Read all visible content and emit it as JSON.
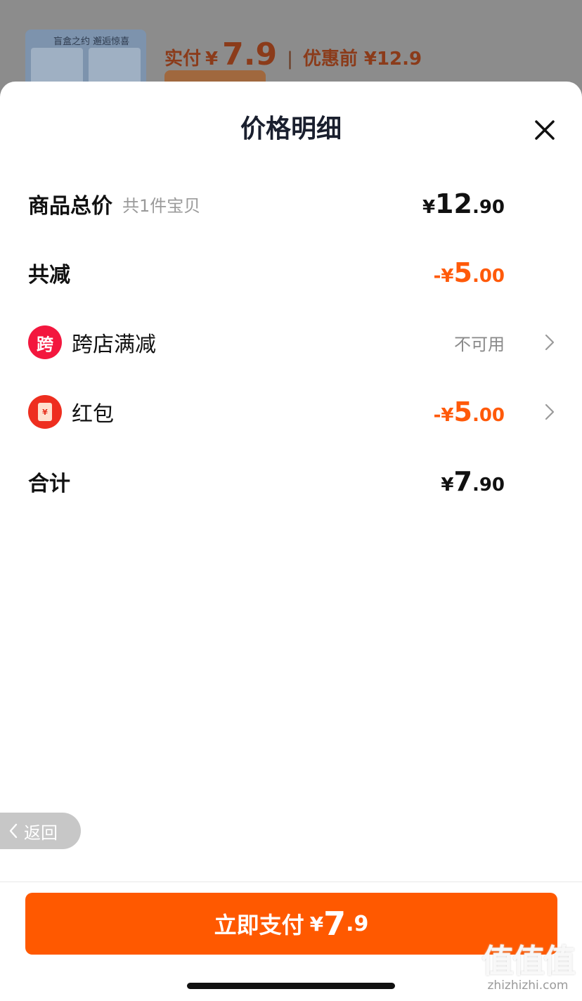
{
  "background": {
    "thumb_title": "盲盒之约 邂逅惊喜",
    "paid_label": "实付",
    "paid_currency": "¥",
    "paid_amount": "7.9",
    "separator": "|",
    "before_discount": "优惠前 ¥12.9"
  },
  "sheet": {
    "title": "价格明细",
    "close_icon": "close-icon"
  },
  "rows": {
    "total": {
      "label": "商品总价",
      "sub": "共1件宝贝",
      "currency": "¥",
      "int": "12",
      "dec": ".90"
    },
    "discount": {
      "label": "共减",
      "sign": "-¥",
      "int": "5",
      "dec": ".00",
      "color": "#ff5a0a"
    },
    "cross_store": {
      "badge": "跨",
      "label": "跨店满减",
      "status": "不可用"
    },
    "red_packet": {
      "badge_symbol": "¥",
      "label": "红包",
      "sign": "-¥",
      "int": "5",
      "dec": ".00"
    },
    "sum": {
      "label": "合计",
      "currency": "¥",
      "int": "7",
      "dec": ".90"
    }
  },
  "back_button": {
    "label": "返回"
  },
  "pay_button": {
    "label": "立即支付",
    "currency": "¥",
    "int": "7",
    "dec": ".9",
    "color": "#ff5900"
  },
  "watermark": {
    "main": "值值值",
    "sub": "zhizhizhi.com"
  }
}
